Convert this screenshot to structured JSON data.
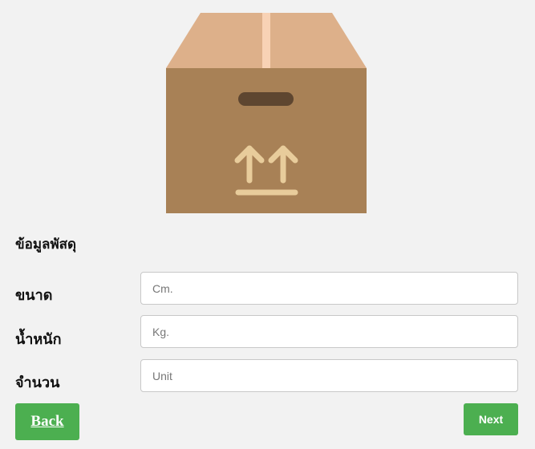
{
  "form": {
    "section_title": "ข้อมูลพัสดุ",
    "fields": [
      {
        "label": "ขนาด",
        "placeholder": "Cm.",
        "value": ""
      },
      {
        "label": "น้ำหนัก",
        "placeholder": "Kg.",
        "value": ""
      },
      {
        "label": "จำนวน",
        "placeholder": "Unit",
        "value": ""
      }
    ]
  },
  "actions": {
    "back_label": "Back",
    "next_label": "Next"
  },
  "colors": {
    "background": "#f2f2f2",
    "button_green": "#4caf50",
    "box_body": "#a88156",
    "box_lid": "#ddb08a",
    "box_tape": "#f8d2b5",
    "box_handle": "#5e4630",
    "box_symbol": "#e8cc9b"
  },
  "icons": {
    "illustration": "cardboard-box-this-side-up-icon"
  }
}
